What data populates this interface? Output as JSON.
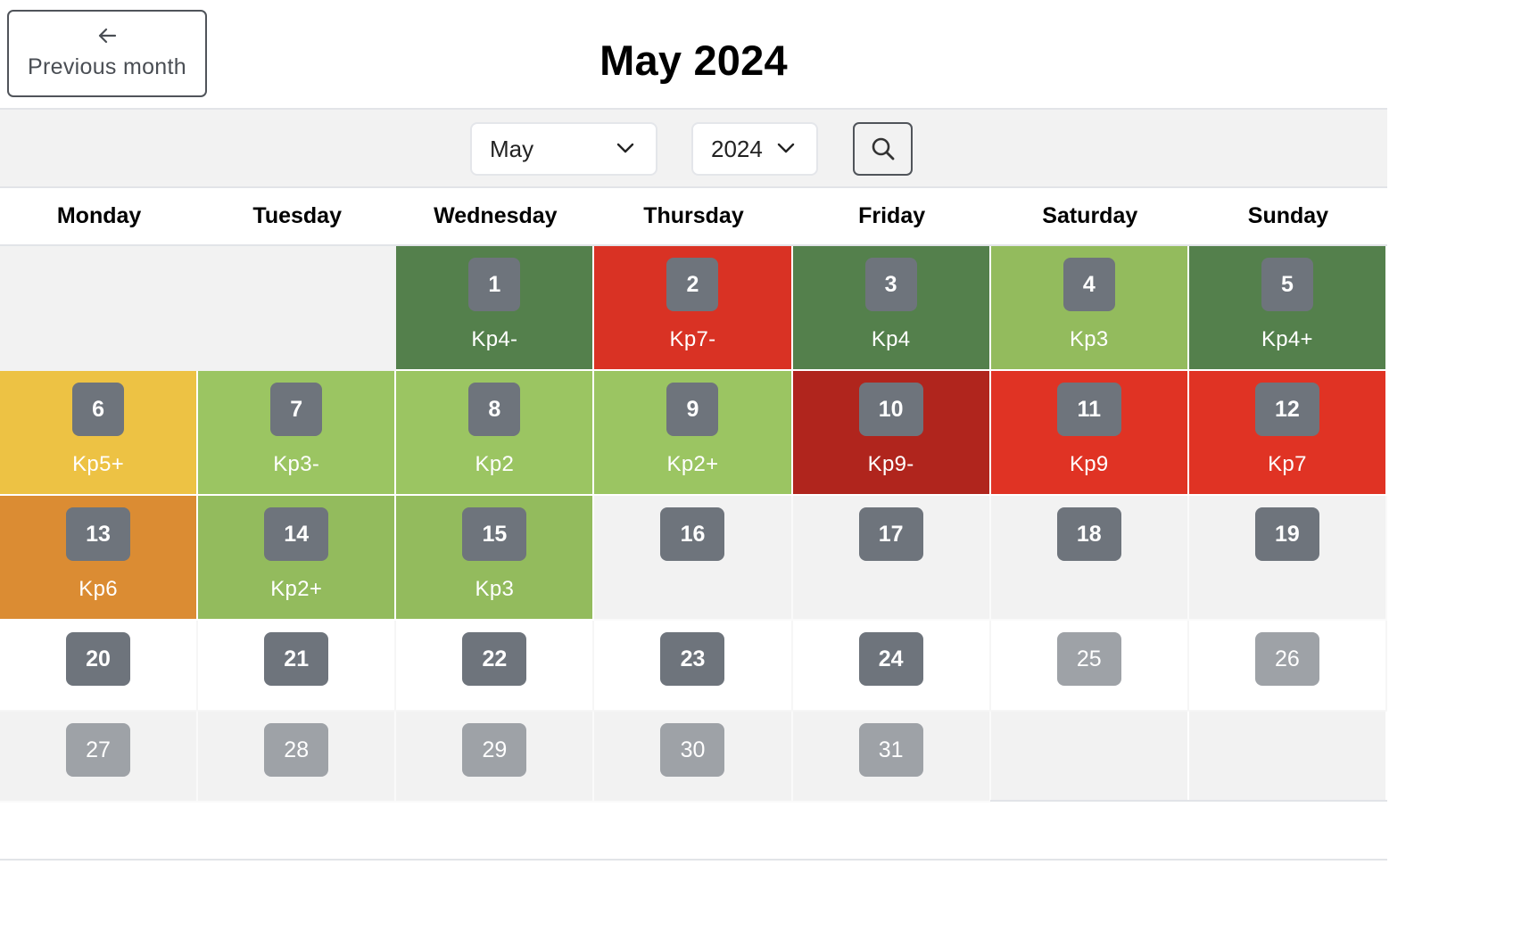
{
  "header": {
    "prev_button_label": "Previous month",
    "prev_icon": "arrow-left-icon",
    "title": "May 2024"
  },
  "toolbar": {
    "month_select": {
      "value": "May",
      "icon": "chevron-down-icon"
    },
    "year_select": {
      "value": "2024",
      "icon": "chevron-down-icon"
    },
    "search_icon": "search-icon"
  },
  "weekdays": [
    "Monday",
    "Tuesday",
    "Wednesday",
    "Thursday",
    "Friday",
    "Saturday",
    "Sunday"
  ],
  "colors": {
    "dark_green": "#54804c",
    "light_green": "#9bc562",
    "mid_green": "#93bb5d",
    "yellow": "#edc244",
    "orange": "#db8c33",
    "red": "#d93224",
    "bright_red": "#e03324",
    "dark_red": "#b0251d",
    "badge": "#6e747c",
    "badge_future": "#9ea2a7"
  },
  "weeks": [
    [
      {
        "day": null
      },
      {
        "day": null
      },
      {
        "day": "1",
        "kp": "Kp4-",
        "color": "#54804c"
      },
      {
        "day": "2",
        "kp": "Kp7-",
        "color": "#d93224"
      },
      {
        "day": "3",
        "kp": "Kp4",
        "color": "#54804c"
      },
      {
        "day": "4",
        "kp": "Kp3",
        "color": "#93bb5d"
      },
      {
        "day": "5",
        "kp": "Kp4+",
        "color": "#54804c"
      }
    ],
    [
      {
        "day": "6",
        "kp": "Kp5+",
        "color": "#edc244"
      },
      {
        "day": "7",
        "kp": "Kp3-",
        "color": "#9bc562"
      },
      {
        "day": "8",
        "kp": "Kp2",
        "color": "#9bc562"
      },
      {
        "day": "9",
        "kp": "Kp2+",
        "color": "#9bc562"
      },
      {
        "day": "10",
        "kp": "Kp9-",
        "color": "#b0251d"
      },
      {
        "day": "11",
        "kp": "Kp9",
        "color": "#e03324"
      },
      {
        "day": "12",
        "kp": "Kp7",
        "color": "#e03324"
      }
    ],
    [
      {
        "day": "13",
        "kp": "Kp6",
        "color": "#db8c33"
      },
      {
        "day": "14",
        "kp": "Kp2+",
        "color": "#93bb5d"
      },
      {
        "day": "15",
        "kp": "Kp3",
        "color": "#93bb5d"
      },
      {
        "day": "16",
        "state": "nodata"
      },
      {
        "day": "17",
        "state": "nodata"
      },
      {
        "day": "18",
        "state": "nodata"
      },
      {
        "day": "19",
        "state": "nodata"
      }
    ],
    [
      {
        "day": "20",
        "state": "white"
      },
      {
        "day": "21",
        "state": "white"
      },
      {
        "day": "22",
        "state": "white"
      },
      {
        "day": "23",
        "state": "white"
      },
      {
        "day": "24",
        "state": "white"
      },
      {
        "day": "25",
        "state": "white",
        "future": true
      },
      {
        "day": "26",
        "state": "white",
        "future": true
      }
    ],
    [
      {
        "day": "27",
        "state": "nodata",
        "future": true
      },
      {
        "day": "28",
        "state": "nodata",
        "future": true
      },
      {
        "day": "29",
        "state": "nodata",
        "future": true
      },
      {
        "day": "30",
        "state": "nodata",
        "future": true
      },
      {
        "day": "31",
        "state": "nodata",
        "future": true
      },
      {
        "day": null,
        "state": "empty"
      },
      {
        "day": null,
        "state": "empty"
      }
    ]
  ]
}
